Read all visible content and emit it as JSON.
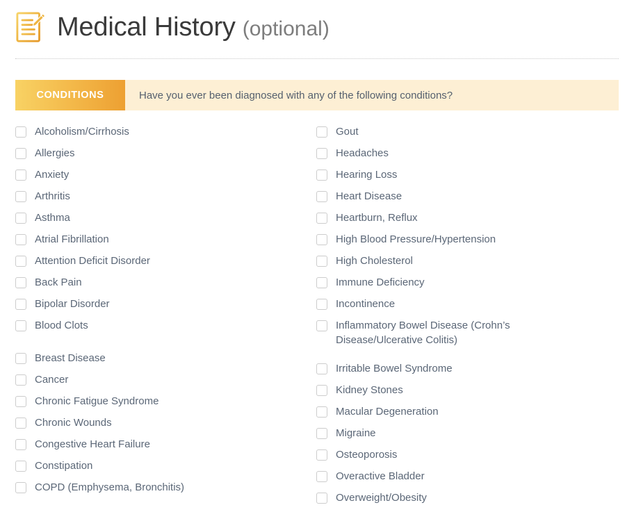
{
  "header": {
    "title": "Medical History",
    "subtitle": "(optional)",
    "icon": "document-pencil-icon",
    "title_color": "#3a3a3a",
    "subtitle_color": "#7d7d7d",
    "icon_color": "#edab35"
  },
  "banner": {
    "tag": "CONDITIONS",
    "question": "Have you ever been diagnosed with any of the following conditions?",
    "tag_gradient_from": "#f8d264",
    "tag_gradient_to": "#eda032",
    "background": "#fdefd4",
    "tag_text_color": "#ffffff",
    "question_color": "#55606e"
  },
  "checkbox": {
    "border_color": "#cccccc",
    "fill_color": "#ffffff",
    "label_color": "#5b6777"
  },
  "conditions": {
    "left_column": [
      {
        "label": "Alcoholism/Cirrhosis",
        "checked": false,
        "gap_before": false
      },
      {
        "label": "Allergies",
        "checked": false,
        "gap_before": false
      },
      {
        "label": "Anxiety",
        "checked": false,
        "gap_before": false
      },
      {
        "label": "Arthritis",
        "checked": false,
        "gap_before": false
      },
      {
        "label": "Asthma",
        "checked": false,
        "gap_before": false
      },
      {
        "label": "Atrial Fibrillation",
        "checked": false,
        "gap_before": false
      },
      {
        "label": "Attention Deficit Disorder",
        "checked": false,
        "gap_before": false
      },
      {
        "label": "Back Pain",
        "checked": false,
        "gap_before": false
      },
      {
        "label": "Bipolar Disorder",
        "checked": false,
        "gap_before": false
      },
      {
        "label": "Blood Clots",
        "checked": false,
        "gap_before": false
      },
      {
        "label": "Breast Disease",
        "checked": false,
        "gap_before": true
      },
      {
        "label": "Cancer",
        "checked": false,
        "gap_before": false
      },
      {
        "label": "Chronic Fatigue Syndrome",
        "checked": false,
        "gap_before": false
      },
      {
        "label": "Chronic Wounds",
        "checked": false,
        "gap_before": false
      },
      {
        "label": "Congestive Heart Failure",
        "checked": false,
        "gap_before": false
      },
      {
        "label": "Constipation",
        "checked": false,
        "gap_before": false
      },
      {
        "label": "COPD (Emphysema, Bronchitis)",
        "checked": false,
        "gap_before": false
      }
    ],
    "right_column": [
      {
        "label": "Gout",
        "checked": false,
        "two_line": false
      },
      {
        "label": "Headaches",
        "checked": false,
        "two_line": false
      },
      {
        "label": "Hearing Loss",
        "checked": false,
        "two_line": false
      },
      {
        "label": "Heart Disease",
        "checked": false,
        "two_line": false
      },
      {
        "label": "Heartburn, Reflux",
        "checked": false,
        "two_line": false
      },
      {
        "label": "High Blood Pressure/Hypertension",
        "checked": false,
        "two_line": false
      },
      {
        "label": "High Cholesterol",
        "checked": false,
        "two_line": false
      },
      {
        "label": "Immune Deficiency",
        "checked": false,
        "two_line": false
      },
      {
        "label": "Incontinence",
        "checked": false,
        "two_line": false
      },
      {
        "label": "Inflammatory Bowel Disease (Crohn’s Disease/Ulcerative Colitis)",
        "checked": false,
        "two_line": true
      },
      {
        "label": "Irritable Bowel Syndrome",
        "checked": false,
        "two_line": false
      },
      {
        "label": "Kidney Stones",
        "checked": false,
        "two_line": false
      },
      {
        "label": "Macular Degeneration",
        "checked": false,
        "two_line": false
      },
      {
        "label": "Migraine",
        "checked": false,
        "two_line": false
      },
      {
        "label": "Osteoporosis",
        "checked": false,
        "two_line": false
      },
      {
        "label": "Overactive Bladder",
        "checked": false,
        "two_line": false
      },
      {
        "label": "Overweight/Obesity",
        "checked": false,
        "two_line": false
      }
    ]
  }
}
